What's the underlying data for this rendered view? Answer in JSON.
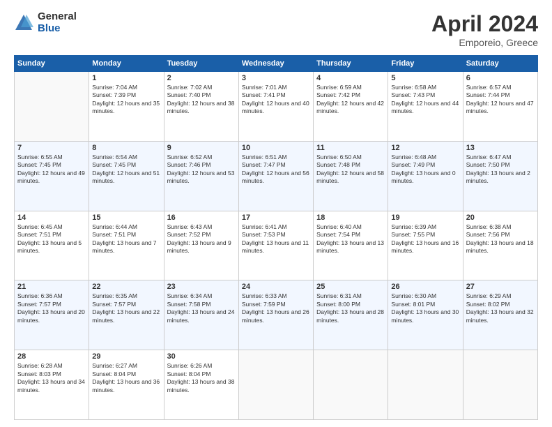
{
  "header": {
    "logo_general": "General",
    "logo_blue": "Blue",
    "title": "April 2024",
    "location": "Emporeio, Greece"
  },
  "weekdays": [
    "Sunday",
    "Monday",
    "Tuesday",
    "Wednesday",
    "Thursday",
    "Friday",
    "Saturday"
  ],
  "weeks": [
    [
      {
        "num": "",
        "sunrise": "",
        "sunset": "",
        "daylight": "",
        "empty": true
      },
      {
        "num": "1",
        "sunrise": "Sunrise: 7:04 AM",
        "sunset": "Sunset: 7:39 PM",
        "daylight": "Daylight: 12 hours and 35 minutes."
      },
      {
        "num": "2",
        "sunrise": "Sunrise: 7:02 AM",
        "sunset": "Sunset: 7:40 PM",
        "daylight": "Daylight: 12 hours and 38 minutes."
      },
      {
        "num": "3",
        "sunrise": "Sunrise: 7:01 AM",
        "sunset": "Sunset: 7:41 PM",
        "daylight": "Daylight: 12 hours and 40 minutes."
      },
      {
        "num": "4",
        "sunrise": "Sunrise: 6:59 AM",
        "sunset": "Sunset: 7:42 PM",
        "daylight": "Daylight: 12 hours and 42 minutes."
      },
      {
        "num": "5",
        "sunrise": "Sunrise: 6:58 AM",
        "sunset": "Sunset: 7:43 PM",
        "daylight": "Daylight: 12 hours and 44 minutes."
      },
      {
        "num": "6",
        "sunrise": "Sunrise: 6:57 AM",
        "sunset": "Sunset: 7:44 PM",
        "daylight": "Daylight: 12 hours and 47 minutes."
      }
    ],
    [
      {
        "num": "7",
        "sunrise": "Sunrise: 6:55 AM",
        "sunset": "Sunset: 7:45 PM",
        "daylight": "Daylight: 12 hours and 49 minutes."
      },
      {
        "num": "8",
        "sunrise": "Sunrise: 6:54 AM",
        "sunset": "Sunset: 7:45 PM",
        "daylight": "Daylight: 12 hours and 51 minutes."
      },
      {
        "num": "9",
        "sunrise": "Sunrise: 6:52 AM",
        "sunset": "Sunset: 7:46 PM",
        "daylight": "Daylight: 12 hours and 53 minutes."
      },
      {
        "num": "10",
        "sunrise": "Sunrise: 6:51 AM",
        "sunset": "Sunset: 7:47 PM",
        "daylight": "Daylight: 12 hours and 56 minutes."
      },
      {
        "num": "11",
        "sunrise": "Sunrise: 6:50 AM",
        "sunset": "Sunset: 7:48 PM",
        "daylight": "Daylight: 12 hours and 58 minutes."
      },
      {
        "num": "12",
        "sunrise": "Sunrise: 6:48 AM",
        "sunset": "Sunset: 7:49 PM",
        "daylight": "Daylight: 13 hours and 0 minutes."
      },
      {
        "num": "13",
        "sunrise": "Sunrise: 6:47 AM",
        "sunset": "Sunset: 7:50 PM",
        "daylight": "Daylight: 13 hours and 2 minutes."
      }
    ],
    [
      {
        "num": "14",
        "sunrise": "Sunrise: 6:45 AM",
        "sunset": "Sunset: 7:51 PM",
        "daylight": "Daylight: 13 hours and 5 minutes."
      },
      {
        "num": "15",
        "sunrise": "Sunrise: 6:44 AM",
        "sunset": "Sunset: 7:51 PM",
        "daylight": "Daylight: 13 hours and 7 minutes."
      },
      {
        "num": "16",
        "sunrise": "Sunrise: 6:43 AM",
        "sunset": "Sunset: 7:52 PM",
        "daylight": "Daylight: 13 hours and 9 minutes."
      },
      {
        "num": "17",
        "sunrise": "Sunrise: 6:41 AM",
        "sunset": "Sunset: 7:53 PM",
        "daylight": "Daylight: 13 hours and 11 minutes."
      },
      {
        "num": "18",
        "sunrise": "Sunrise: 6:40 AM",
        "sunset": "Sunset: 7:54 PM",
        "daylight": "Daylight: 13 hours and 13 minutes."
      },
      {
        "num": "19",
        "sunrise": "Sunrise: 6:39 AM",
        "sunset": "Sunset: 7:55 PM",
        "daylight": "Daylight: 13 hours and 16 minutes."
      },
      {
        "num": "20",
        "sunrise": "Sunrise: 6:38 AM",
        "sunset": "Sunset: 7:56 PM",
        "daylight": "Daylight: 13 hours and 18 minutes."
      }
    ],
    [
      {
        "num": "21",
        "sunrise": "Sunrise: 6:36 AM",
        "sunset": "Sunset: 7:57 PM",
        "daylight": "Daylight: 13 hours and 20 minutes."
      },
      {
        "num": "22",
        "sunrise": "Sunrise: 6:35 AM",
        "sunset": "Sunset: 7:57 PM",
        "daylight": "Daylight: 13 hours and 22 minutes."
      },
      {
        "num": "23",
        "sunrise": "Sunrise: 6:34 AM",
        "sunset": "Sunset: 7:58 PM",
        "daylight": "Daylight: 13 hours and 24 minutes."
      },
      {
        "num": "24",
        "sunrise": "Sunrise: 6:33 AM",
        "sunset": "Sunset: 7:59 PM",
        "daylight": "Daylight: 13 hours and 26 minutes."
      },
      {
        "num": "25",
        "sunrise": "Sunrise: 6:31 AM",
        "sunset": "Sunset: 8:00 PM",
        "daylight": "Daylight: 13 hours and 28 minutes."
      },
      {
        "num": "26",
        "sunrise": "Sunrise: 6:30 AM",
        "sunset": "Sunset: 8:01 PM",
        "daylight": "Daylight: 13 hours and 30 minutes."
      },
      {
        "num": "27",
        "sunrise": "Sunrise: 6:29 AM",
        "sunset": "Sunset: 8:02 PM",
        "daylight": "Daylight: 13 hours and 32 minutes."
      }
    ],
    [
      {
        "num": "28",
        "sunrise": "Sunrise: 6:28 AM",
        "sunset": "Sunset: 8:03 PM",
        "daylight": "Daylight: 13 hours and 34 minutes."
      },
      {
        "num": "29",
        "sunrise": "Sunrise: 6:27 AM",
        "sunset": "Sunset: 8:04 PM",
        "daylight": "Daylight: 13 hours and 36 minutes."
      },
      {
        "num": "30",
        "sunrise": "Sunrise: 6:26 AM",
        "sunset": "Sunset: 8:04 PM",
        "daylight": "Daylight: 13 hours and 38 minutes."
      },
      {
        "num": "",
        "sunrise": "",
        "sunset": "",
        "daylight": "",
        "empty": true
      },
      {
        "num": "",
        "sunrise": "",
        "sunset": "",
        "daylight": "",
        "empty": true
      },
      {
        "num": "",
        "sunrise": "",
        "sunset": "",
        "daylight": "",
        "empty": true
      },
      {
        "num": "",
        "sunrise": "",
        "sunset": "",
        "daylight": "",
        "empty": true
      }
    ]
  ]
}
